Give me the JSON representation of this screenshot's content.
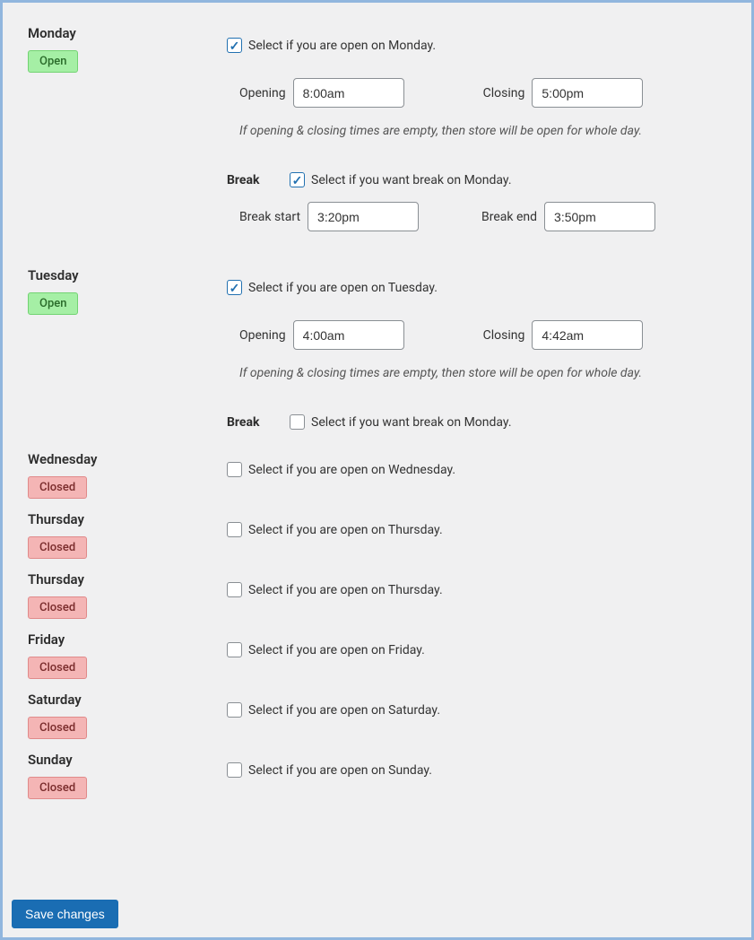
{
  "labels": {
    "opening": "Opening",
    "closing": "Closing",
    "break": "Break",
    "break_start": "Break start",
    "break_end": "Break end",
    "helper_text": "If opening & closing times are empty, then store will be open for whole day.",
    "save_button": "Save changes",
    "status_open": "Open",
    "status_closed": "Closed"
  },
  "days": [
    {
      "name": "Monday",
      "status": "open",
      "open_checked": true,
      "open_text": "Select if you are open on Monday.",
      "opening": "8:00am",
      "closing": "5:00pm",
      "break_checked": true,
      "break_text": "Select if you want break on Monday.",
      "break_start": "3:20pm",
      "break_end": "3:50pm"
    },
    {
      "name": "Tuesday",
      "status": "open",
      "open_checked": true,
      "open_text": "Select if you are open on Tuesday.",
      "opening": "4:00am",
      "closing": "4:42am",
      "break_checked": false,
      "break_text": "Select if you want break on Monday."
    },
    {
      "name": "Wednesday",
      "status": "closed",
      "open_checked": false,
      "open_text": "Select if you are open on Wednesday."
    },
    {
      "name": "Thursday",
      "status": "closed",
      "open_checked": false,
      "open_text": "Select if you are open on Thursday."
    },
    {
      "name": "Thursday",
      "status": "closed",
      "open_checked": false,
      "open_text": "Select if you are open on Thursday."
    },
    {
      "name": "Friday",
      "status": "closed",
      "open_checked": false,
      "open_text": "Select if you are open on Friday."
    },
    {
      "name": "Saturday",
      "status": "closed",
      "open_checked": false,
      "open_text": "Select if you are open on Saturday."
    },
    {
      "name": "Sunday",
      "status": "closed",
      "open_checked": false,
      "open_text": "Select if you are open on Sunday."
    }
  ]
}
